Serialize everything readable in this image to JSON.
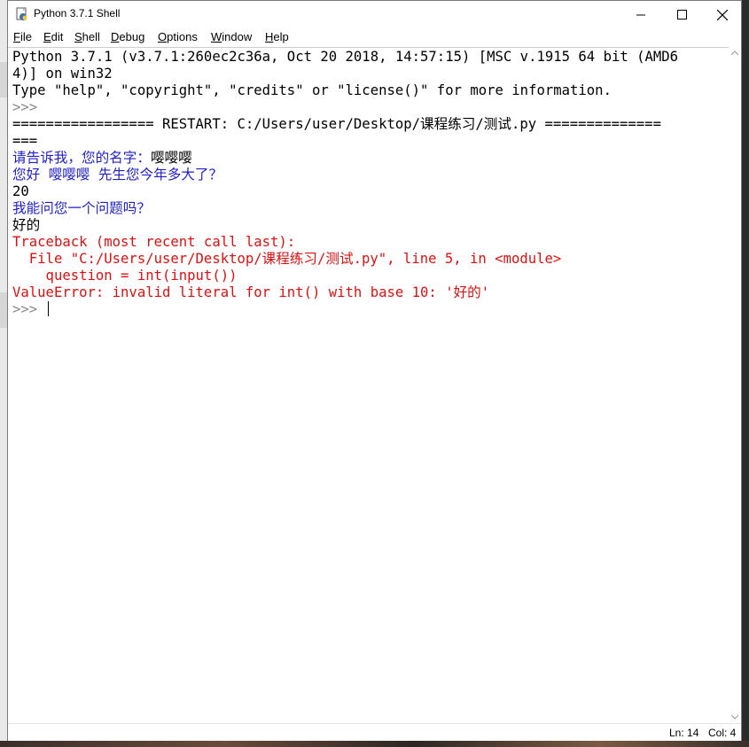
{
  "window": {
    "title": "Python 3.7.1 Shell",
    "icon": "python-idle-icon"
  },
  "menu": [
    "File",
    "Edit",
    "Shell",
    "Debug",
    "Options",
    "Window",
    "Help"
  ],
  "menu_mnemonics": [
    "F",
    "E",
    "S",
    "D",
    "O",
    "W",
    "H"
  ],
  "shell": {
    "lines": [
      {
        "text": "Python 3.7.1 (v3.7.1:260ec2c36a, Oct 20 2018, 14:57:15) [MSC v.1915 64 bit (AMD6",
        "color": "black"
      },
      {
        "text": "4)] on win32",
        "color": "black"
      },
      {
        "text": "Type \"help\", \"copyright\", \"credits\" or \"license()\" for more information.",
        "color": "black"
      },
      {
        "text": ">>> ",
        "color": "prompt"
      },
      {
        "text": "================= RESTART: C:/Users/user/Desktop/课程练习/测试.py ==============",
        "color": "black"
      },
      {
        "text": "===",
        "color": "black"
      },
      {
        "text": "请告诉我，您的名字：",
        "color": "blue",
        "input": "嘤嘤嘤"
      },
      {
        "text": "您好 嘤嘤嘤 先生您今年多大了？",
        "color": "blue"
      },
      {
        "text": "20",
        "color": "black"
      },
      {
        "text": "我能问您一个问题吗？",
        "color": "blue"
      },
      {
        "text": "好的",
        "color": "black"
      },
      {
        "text": "Traceback (most recent call last):",
        "color": "red"
      },
      {
        "text": "  File \"C:/Users/user/Desktop/课程练习/测试.py\", line 5, in <module>",
        "color": "red"
      },
      {
        "text": "    question = int(input())",
        "color": "red"
      },
      {
        "text": "ValueError: invalid literal for int() with base 10: '好的'",
        "color": "red"
      }
    ],
    "prompt": ">>> "
  },
  "status": {
    "ln": "Ln: 14",
    "col": "Col: 4"
  },
  "colors": {
    "output_blue": "#1f1fd0",
    "error_red": "#e01010",
    "prompt_gray": "#8a8a8a"
  }
}
